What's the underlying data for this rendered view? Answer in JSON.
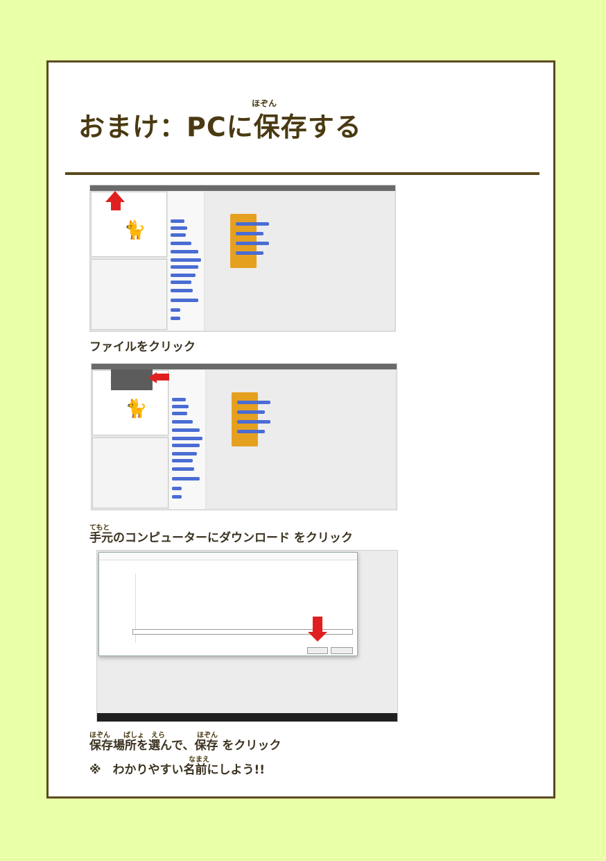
{
  "title": {
    "main": "おまけ：PCに保存する",
    "ruby": "ほぞん"
  },
  "steps": [
    {
      "caption": "ファイルをクリック"
    },
    {
      "caption": "手元のコンピューターにダウンロード をクリック",
      "ruby": "てもと"
    },
    {
      "caption": "保存場所を選んで、保存 をクリック",
      "ruby1": "ほぞん",
      "ruby2": "ばしょ",
      "ruby3": "えら",
      "ruby4": "ほぞん"
    }
  ],
  "note": {
    "text": "※　わかりやすい名前にしよう!!",
    "ruby": "なまえ"
  },
  "colors": {
    "band": "#e9ffa8",
    "border": "#5a4a1e",
    "title": "#4a3a12"
  },
  "icons": [
    "red-arrow-icon",
    "scratch-cat-icon"
  ]
}
